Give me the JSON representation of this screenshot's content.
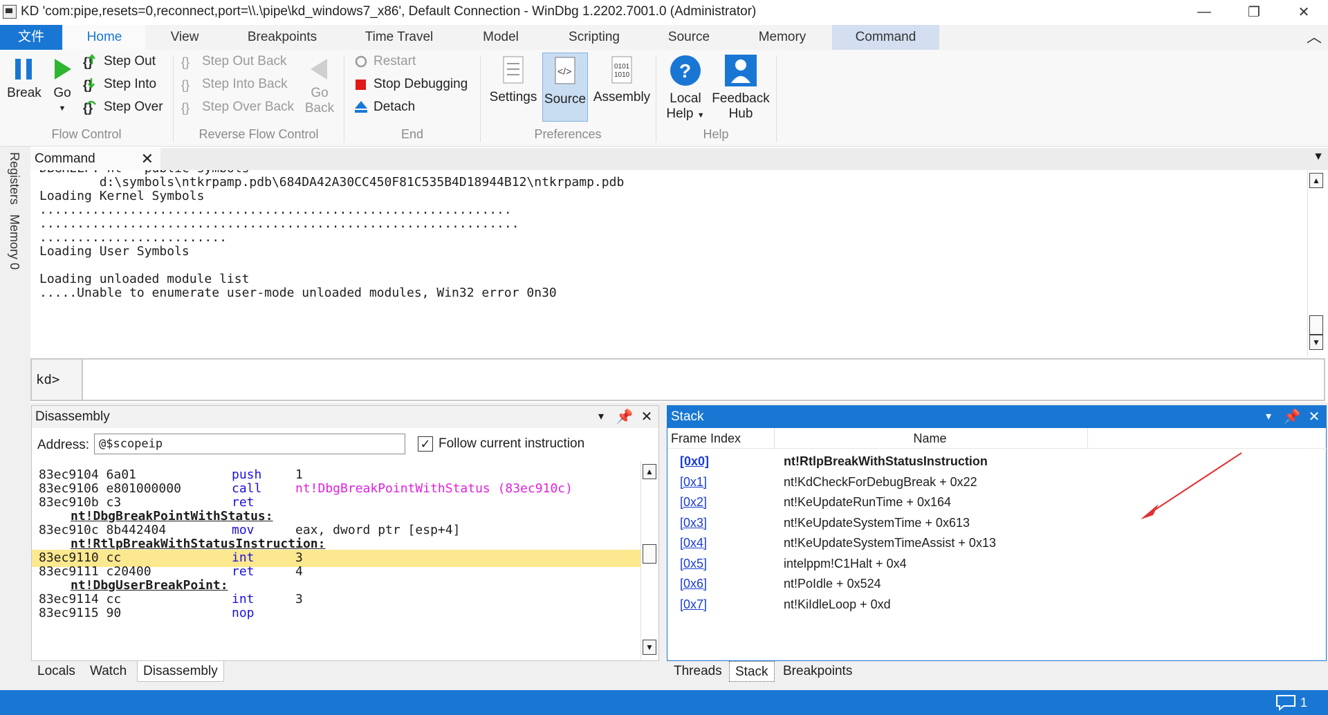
{
  "window": {
    "title": "KD 'com:pipe,resets=0,reconnect,port=\\\\.\\pipe\\kd_windows7_x86', Default Connection  - WinDbg 1.2202.7001.0 (Administrator)",
    "minimize": "—",
    "restore": "❐",
    "close": "✕"
  },
  "ribbon": {
    "tabs": [
      "文件",
      "Home",
      "View",
      "Breakpoints",
      "Time Travel",
      "Model",
      "Scripting",
      "Source",
      "Memory",
      "Command"
    ],
    "collapse": "︿",
    "flow": {
      "break": "Break",
      "go": "Go",
      "step_out": "Step Out",
      "step_into": "Step Into",
      "step_over": "Step Over",
      "group": "Flow Control"
    },
    "reverse": {
      "step_out_back": "Step Out Back",
      "step_into_back": "Step Into Back",
      "step_over_back": "Step Over Back",
      "go_back_1": "Go",
      "go_back_2": "Back",
      "group": "Reverse Flow Control"
    },
    "end": {
      "restart": "Restart",
      "stop": "Stop Debugging",
      "detach": "Detach",
      "group": "End"
    },
    "prefs": {
      "settings": "Settings",
      "source": "Source",
      "assembly": "Assembly",
      "group": "Preferences"
    },
    "help": {
      "local_1": "Local",
      "local_2": "Help",
      "feedback_1": "Feedback",
      "feedback_2": "Hub",
      "group": "Help"
    }
  },
  "side_tabs": {
    "registers": "Registers",
    "memory": "Memory 0"
  },
  "command": {
    "tab": "Command",
    "lines": [
      "DBGHELP: nt - public symbols",
      "        d:\\symbols\\ntkrpamp.pdb\\684DA42A30CC450F81C535B4D18944B12\\ntkrpamp.pdb",
      "Loading Kernel Symbols",
      "...............................................................",
      "................................................................",
      ".........................",
      "Loading User Symbols",
      "",
      "Loading unloaded module list",
      ".....Unable to enumerate user-mode unloaded modules, Win32 error 0n30"
    ],
    "prompt": "kd>",
    "input_value": ""
  },
  "disassembly": {
    "title": "Disassembly",
    "address_label": "Address:",
    "address_value": "@$scopeip",
    "follow_label": "Follow current instruction",
    "follow_checked": "✓",
    "lines": [
      {
        "addr": "83ec9104 6a01",
        "mn": "push",
        "op": "1",
        "op_color": "#1e1e1e",
        "label": false,
        "highlight": false
      },
      {
        "addr": "83ec9106 e801000000",
        "mn": "call",
        "op": "nt!DbgBreakPointWithStatus (83ec910c)",
        "op_color": "#e020e0",
        "label": false,
        "highlight": false
      },
      {
        "addr": "83ec910b c3",
        "mn": "ret",
        "op": "",
        "op_color": "#1e1e1e",
        "label": false,
        "highlight": false
      },
      {
        "addr": "nt!DbgBreakPointWithStatus:",
        "mn": "",
        "op": "",
        "op_color": "#1e1e1e",
        "label": true,
        "highlight": false
      },
      {
        "addr": "83ec910c 8b442404",
        "mn": "mov",
        "op": "eax, dword ptr [esp+4]",
        "op_color": "#1e1e1e",
        "label": false,
        "highlight": false
      },
      {
        "addr": "nt!RtlpBreakWithStatusInstruction:",
        "mn": "",
        "op": "",
        "op_color": "#1e1e1e",
        "label": true,
        "highlight": false
      },
      {
        "addr": "83ec9110 cc",
        "mn": "int",
        "op": "3",
        "op_color": "#1e1e1e",
        "label": false,
        "highlight": true
      },
      {
        "addr": "83ec9111 c20400",
        "mn": "ret",
        "op": "4",
        "op_color": "#1e1e1e",
        "label": false,
        "highlight": false
      },
      {
        "addr": "nt!DbgUserBreakPoint:",
        "mn": "",
        "op": "",
        "op_color": "#1e1e1e",
        "label": true,
        "highlight": false
      },
      {
        "addr": "83ec9114 cc",
        "mn": "int",
        "op": "3",
        "op_color": "#1e1e1e",
        "label": false,
        "highlight": false
      },
      {
        "addr": "83ec9115 90",
        "mn": "nop",
        "op": "",
        "op_color": "#1e1e1e",
        "label": false,
        "highlight": false
      }
    ],
    "bottom_tabs": [
      "Locals",
      "Watch",
      "Disassembly"
    ]
  },
  "stack": {
    "title": "Stack",
    "col_frame": "Frame Index",
    "col_name": "Name",
    "rows": [
      {
        "index": "[0x0]",
        "name": "nt!RtlpBreakWithStatusInstruction",
        "bold": true
      },
      {
        "index": "[0x1]",
        "name": "nt!KdCheckForDebugBreak + 0x22",
        "bold": false
      },
      {
        "index": "[0x2]",
        "name": "nt!KeUpdateRunTime + 0x164",
        "bold": false
      },
      {
        "index": "[0x3]",
        "name": "nt!KeUpdateSystemTime + 0x613",
        "bold": false
      },
      {
        "index": "[0x4]",
        "name": "nt!KeUpdateSystemTimeAssist + 0x13",
        "bold": false
      },
      {
        "index": "[0x5]",
        "name": "intelppm!C1Halt + 0x4",
        "bold": false
      },
      {
        "index": "[0x6]",
        "name": "nt!PoIdle + 0x524",
        "bold": false
      },
      {
        "index": "[0x7]",
        "name": "nt!KiIdleLoop + 0xd",
        "bold": false
      }
    ],
    "bottom_tabs": [
      "Threads",
      "Stack",
      "Breakpoints"
    ]
  },
  "pane_buttons": {
    "dropdown": "▾",
    "pin": "⊣",
    "close": "✕"
  },
  "status": {
    "notifications": "1"
  },
  "colors": {
    "accent": "#1977d3",
    "highlight": "#fce88e",
    "annotation_arrow": "#e03030"
  }
}
